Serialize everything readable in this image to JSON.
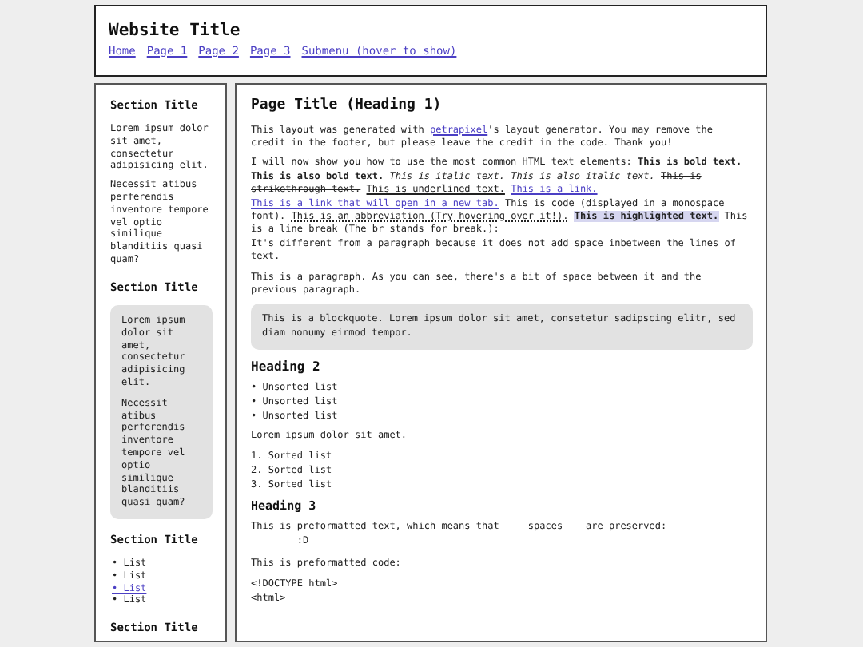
{
  "header": {
    "title": "Website Title",
    "nav": [
      "Home",
      "Page 1",
      "Page 2",
      "Page 3",
      "Submenu (hover to show)"
    ]
  },
  "sidebar": {
    "sections": [
      {
        "title": "Section Title",
        "blocks": [
          {
            "kind": "p",
            "text": "Lorem ipsum dolor sit amet, consectetur adipisicing elit."
          },
          {
            "kind": "p",
            "text": "Necessit atibus perferendis inventore tempore vel optio similique blanditiis quasi quam?"
          }
        ]
      },
      {
        "title": "Section Title",
        "blocks": [
          {
            "kind": "quote",
            "paragraphs": [
              "Lorem ipsum dolor sit amet, consectetur adipisicing elit.",
              "Necessit atibus perferendis inventore tempore vel optio similique blanditiis quasi quam?"
            ]
          }
        ]
      },
      {
        "title": "Section Title",
        "blocks": [
          {
            "kind": "list",
            "items": [
              {
                "text": "• List",
                "link": false
              },
              {
                "text": "• List",
                "link": false
              },
              {
                "text": "• List",
                "link": true
              },
              {
                "text": "• List",
                "link": false
              }
            ]
          }
        ]
      },
      {
        "title": "Section Title"
      }
    ]
  },
  "main": {
    "title": "Page Title (Heading 1)",
    "blocks": [
      {
        "kind": "p",
        "segments": [
          {
            "kind": "text",
            "text": "This layout was generated with "
          },
          {
            "kind": "link",
            "text": "petrapixel"
          },
          {
            "kind": "text",
            "text": "'s layout generator. You may remove the credit in the footer, but please leave the credit in the code. Thank you!"
          }
        ]
      },
      {
        "kind": "p",
        "segments": [
          {
            "kind": "text",
            "text": "I will now show you how to use the most common HTML text elements: "
          },
          {
            "kind": "bold",
            "text": "This is bold text."
          },
          {
            "kind": "bold",
            "text": "This is also bold text."
          },
          {
            "kind": "italic",
            "text": "This is italic text."
          },
          {
            "kind": "italic",
            "text": "This is also italic text."
          },
          {
            "kind": "strike",
            "text": "This is strikethrough text."
          },
          {
            "kind": "underline",
            "text": "This is underlined text."
          },
          {
            "kind": "link",
            "text": "This is a link."
          },
          {
            "kind": "link",
            "text": "This is a link that will open in a new tab."
          },
          {
            "kind": "code",
            "text": "This is code (displayed in a monospace font)."
          },
          {
            "kind": "abbr",
            "text": "This is an abbreviation (Try hovering over it!)."
          },
          {
            "kind": "mark",
            "text": "This is highlighted text."
          },
          {
            "kind": "text",
            "text": " This is a line break (The br stands for break.):"
          },
          {
            "kind": "br"
          },
          {
            "kind": "text",
            "text": "It's different from a paragraph because it does not add space inbetween the lines of text."
          }
        ]
      },
      {
        "kind": "p",
        "segments": [
          {
            "kind": "text",
            "text": "This is a paragraph. As you can see, there's a bit of space between it and the previous paragraph."
          }
        ]
      },
      {
        "kind": "quote",
        "text": "This is a blockquote. Lorem ipsum dolor sit amet, consetetur sadipscing elitr, sed diam nonumy eirmod tempor."
      },
      {
        "kind": "h2",
        "text": "Heading 2"
      },
      {
        "kind": "list",
        "items": [
          "• Unsorted list",
          "• Unsorted list",
          "• Unsorted list"
        ]
      },
      {
        "kind": "p",
        "segments": [
          {
            "kind": "text",
            "text": "Lorem ipsum dolor sit amet."
          }
        ]
      },
      {
        "kind": "list",
        "items": [
          "1. Sorted list",
          "2. Sorted list",
          "3. Sorted list"
        ]
      },
      {
        "kind": "h3",
        "text": "Heading 3"
      },
      {
        "kind": "pre",
        "text": "This is preformatted text, which means that     spaces    are preserved:\n        :D"
      },
      {
        "kind": "p",
        "segments": [
          {
            "kind": "text",
            "text": "This is preformatted code:"
          }
        ]
      },
      {
        "kind": "pre",
        "text": "<!DOCTYPE html>\n<html>"
      }
    ]
  }
}
